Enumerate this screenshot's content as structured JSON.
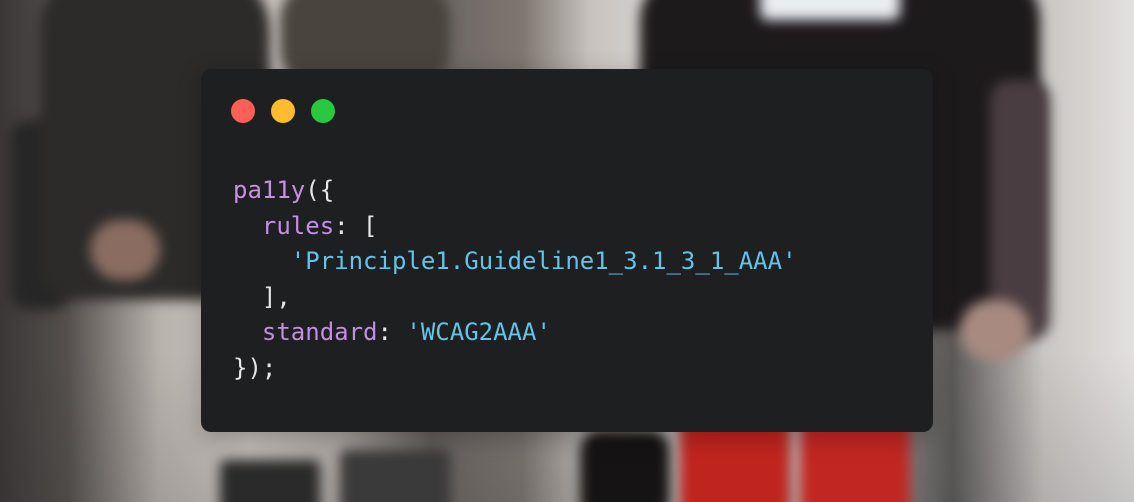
{
  "window": {
    "controls": [
      "close",
      "minimize",
      "maximize"
    ],
    "colors": {
      "close": "#ff5f57",
      "minimize": "#febc2e",
      "maximize": "#28c840",
      "background": "#1e1f21"
    }
  },
  "code": {
    "fn_name": "pa11y",
    "open": "({",
    "rules_key": "rules",
    "rules_colon": ": [",
    "rule_value": "'Principle1.Guideline1_3.1_3_1_AAA'",
    "rules_close": "],",
    "standard_key": "standard",
    "standard_colon": ": ",
    "standard_value": "'WCAG2AAA'",
    "close": "});"
  },
  "syntax_colors": {
    "function": "#c990e0",
    "property": "#c38fe0",
    "string": "#63c3e8",
    "punctuation": "#e6e6e6"
  }
}
